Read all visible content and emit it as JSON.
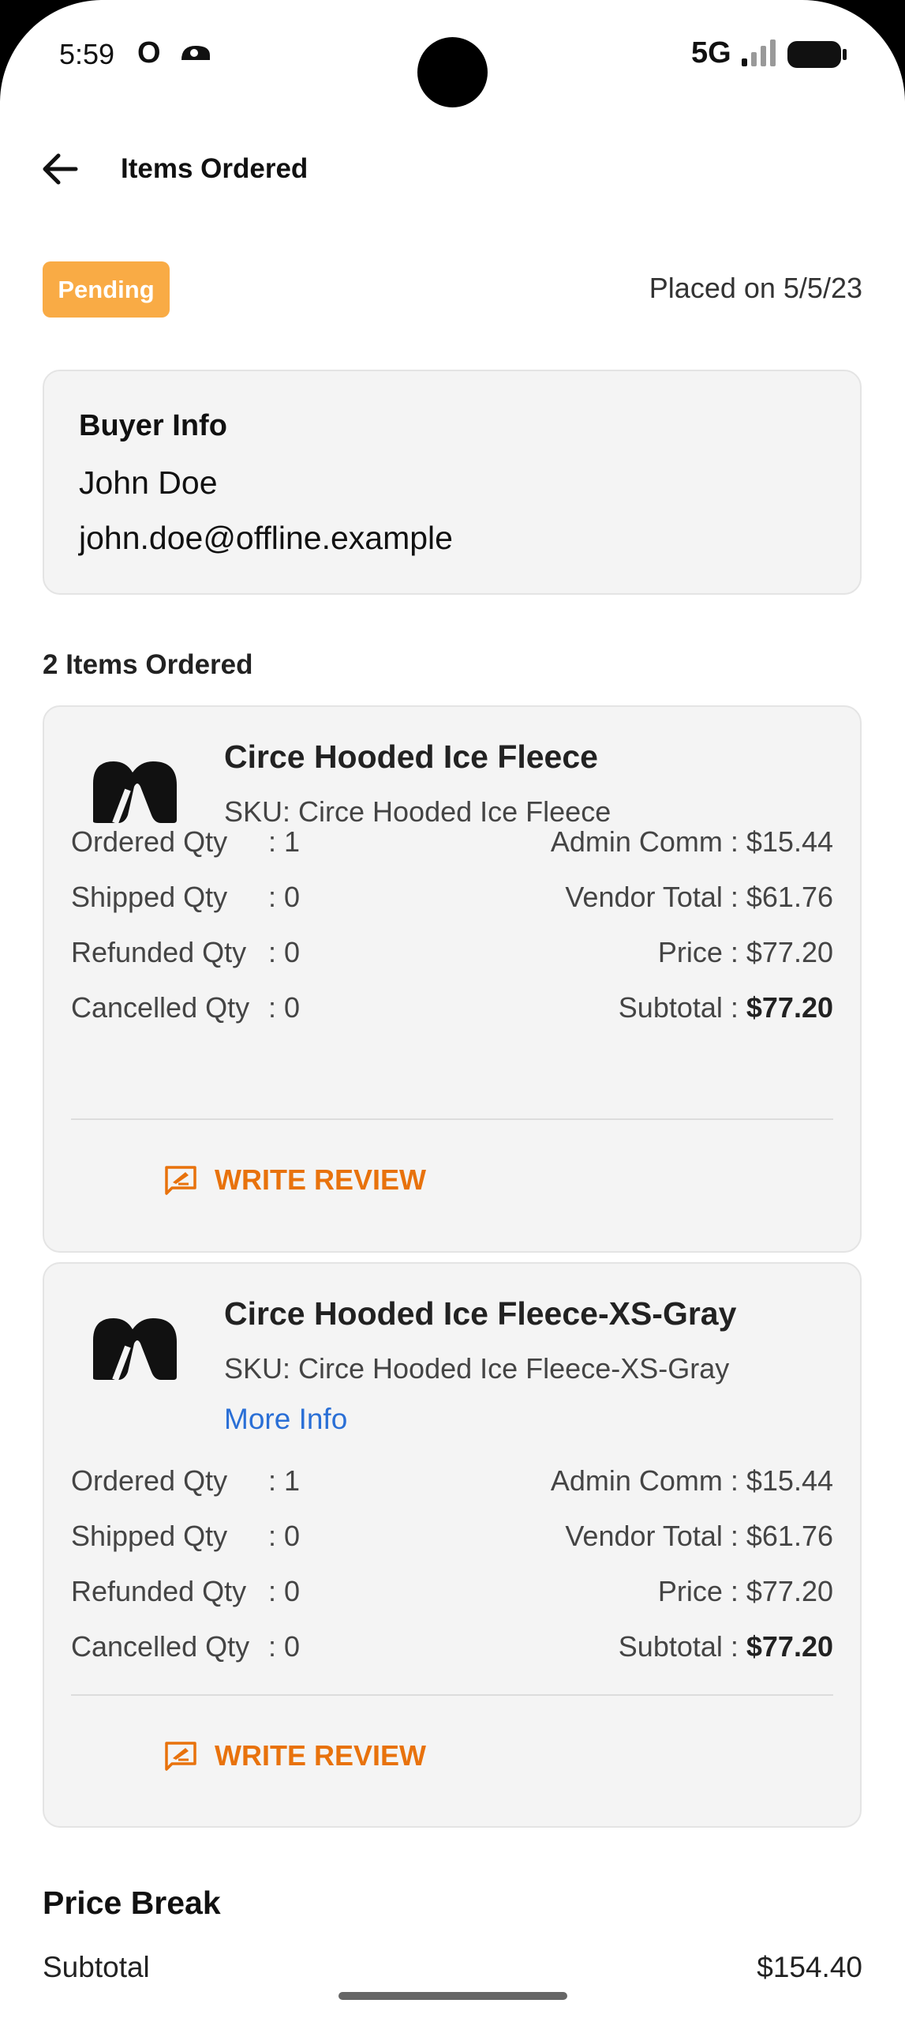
{
  "status_bar": {
    "time": "5:59",
    "o_glyph": "O",
    "network": "5G",
    "icons": [
      "data-saver-icon",
      "signal-icon",
      "battery-icon"
    ]
  },
  "app_bar": {
    "title": "Items Ordered",
    "back_icon": "arrow-left-icon"
  },
  "order": {
    "status": "Pending",
    "status_color": "#f9ab45",
    "placed": "Placed on 5/5/23"
  },
  "buyer": {
    "title": "Buyer Info",
    "name": "John Doe",
    "email": "john.doe@offline.example"
  },
  "items_heading": "2 Items Ordered",
  "items": [
    {
      "name": "Circe Hooded Ice Fleece",
      "sku": "SKU: Circe Hooded Ice Fleece",
      "more_info": "",
      "qty": [
        {
          "label": "Ordered Qty",
          "value": ": 1"
        },
        {
          "label": "Shipped Qty",
          "value": ": 0"
        },
        {
          "label": "Refunded Qty",
          "value": ": 0"
        },
        {
          "label": "Cancelled Qty",
          "value": ": 0"
        }
      ],
      "amounts": [
        {
          "label": "Admin Comm : ",
          "value": "$15.44"
        },
        {
          "label": "Vendor Total : ",
          "value": "$61.76"
        },
        {
          "label": "Price : ",
          "value": "$77.20"
        },
        {
          "label": "Subtotal : ",
          "value": "$77.20"
        }
      ],
      "review_label": "WRITE REVIEW"
    },
    {
      "name": "Circe Hooded Ice Fleece-XS-Gray",
      "sku": "SKU: Circe Hooded Ice Fleece-XS-Gray",
      "more_info": "More Info",
      "qty": [
        {
          "label": "Ordered Qty",
          "value": ": 1"
        },
        {
          "label": "Shipped Qty",
          "value": ": 0"
        },
        {
          "label": "Refunded Qty",
          "value": ": 0"
        },
        {
          "label": "Cancelled Qty",
          "value": ": 0"
        }
      ],
      "amounts": [
        {
          "label": "Admin Comm : ",
          "value": "$15.44"
        },
        {
          "label": "Vendor Total : ",
          "value": "$61.76"
        },
        {
          "label": "Price : ",
          "value": "$77.20"
        },
        {
          "label": "Subtotal : ",
          "value": "$77.20"
        }
      ],
      "review_label": "WRITE REVIEW"
    }
  ],
  "price_break": {
    "title": "Price Break",
    "subtotal_label": "Subtotal",
    "subtotal_value": "$154.40"
  },
  "colors": {
    "accent": "#e8720c",
    "link": "#2a6fd6",
    "badge": "#f9ab45"
  }
}
